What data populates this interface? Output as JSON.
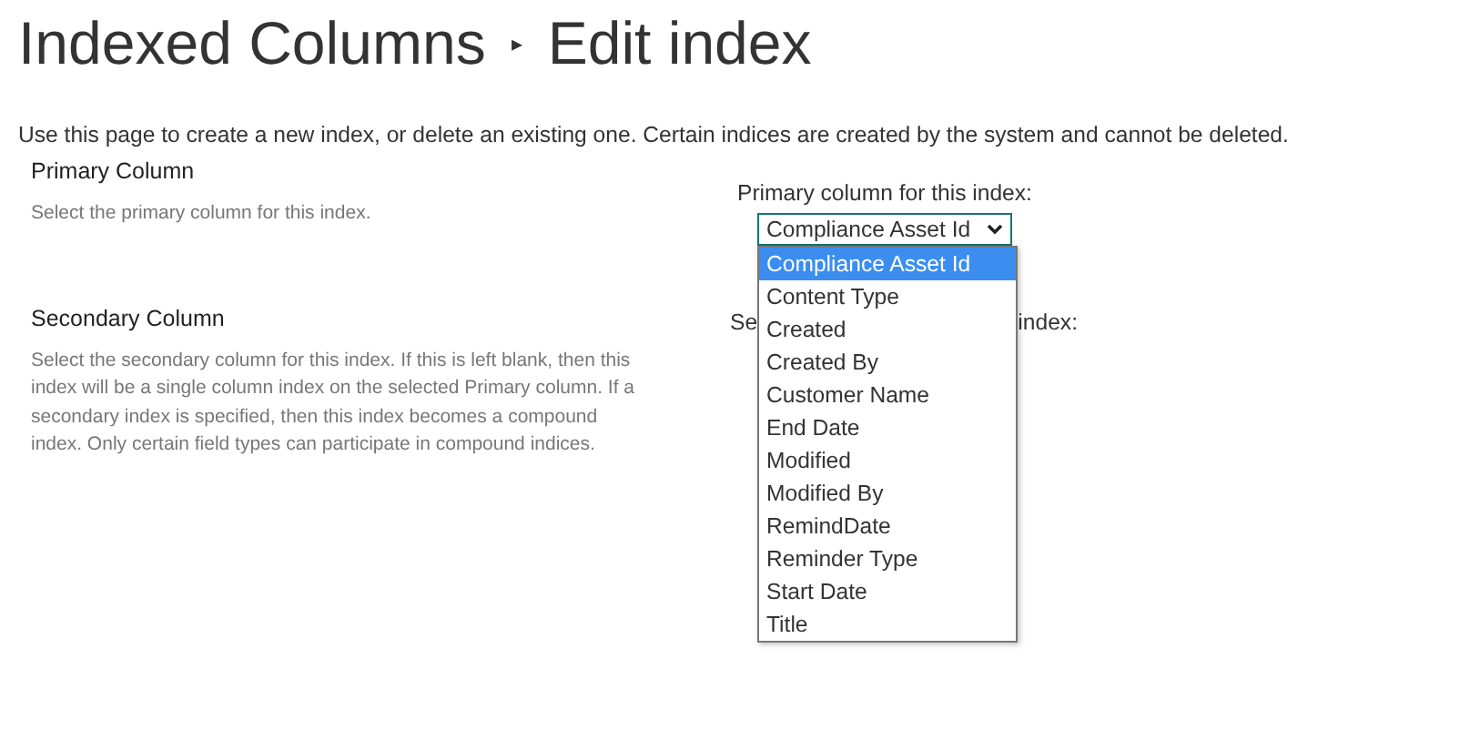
{
  "breadcrumb": {
    "parent": "Indexed Columns",
    "separator": "▸",
    "current": "Edit index"
  },
  "intro": "Use this page to create a new index, or delete an existing one. Certain indices are created by the system and cannot be deleted.",
  "sections": [
    {
      "heading": "Primary Column",
      "description": "Select the primary column for this index."
    },
    {
      "heading": "Secondary Column",
      "description": "Select the secondary column for this index. If this is left blank, then this index will be a single column index on the selected Primary column. If a secondary index is specified, then this index becomes a compound index. Only certain field types can participate in compound indices."
    }
  ],
  "primary_field": {
    "label": "Primary column for this index:",
    "value": "Compliance Asset Id",
    "expanded": true,
    "options": [
      {
        "label": "Compliance Asset Id",
        "selected": true
      },
      {
        "label": "Content Type",
        "selected": false
      },
      {
        "label": "Created",
        "selected": false
      },
      {
        "label": "Created By",
        "selected": false
      },
      {
        "label": "Customer Name",
        "selected": false
      },
      {
        "label": "End Date",
        "selected": false
      },
      {
        "label": "Modified",
        "selected": false
      },
      {
        "label": "Modified By",
        "selected": false
      },
      {
        "label": "RemindDate",
        "selected": false
      },
      {
        "label": "Reminder Type",
        "selected": false
      },
      {
        "label": "Start Date",
        "selected": false
      },
      {
        "label": "Title",
        "selected": false
      }
    ]
  },
  "secondary_field": {
    "label_parts": [
      "Se",
      "index:"
    ]
  }
}
